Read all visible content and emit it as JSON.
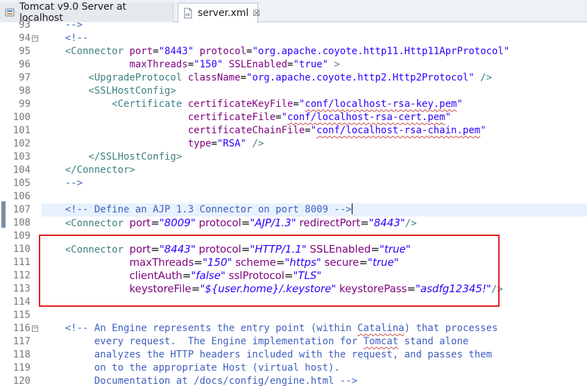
{
  "tabs": [
    {
      "label": "Tomcat v9.0 Server at localhost",
      "icon": "server-icon",
      "active": false
    },
    {
      "label": "server.xml",
      "icon": "xml-file-icon",
      "active": true,
      "close": "☒"
    }
  ],
  "colors": {
    "comment": "#3f5fbf",
    "tag": "#3f7f7f",
    "attr_name": "#7f007f",
    "attr_value": "#2a00ff",
    "highlight_box": "#e01b1b"
  },
  "editor": {
    "lines": [
      {
        "n": "93",
        "t": [
          {
            "c": "cm",
            "s": "    -->"
          }
        ]
      },
      {
        "n": "94",
        "fold": "−",
        "t": [
          {
            "c": "cm",
            "s": "    <!--"
          }
        ]
      },
      {
        "n": "95",
        "t": [
          {
            "c": "tg",
            "s": "    <Connector "
          },
          {
            "c": "an",
            "s": "port"
          },
          {
            "c": "",
            "s": "="
          },
          {
            "c": "av",
            "s": "\"8443\""
          },
          {
            "c": "",
            "s": " "
          },
          {
            "c": "an",
            "s": "protocol"
          },
          {
            "c": "",
            "s": "="
          },
          {
            "c": "av",
            "s": "\"org.apache.coyote.http11.Http11AprProtocol\""
          }
        ]
      },
      {
        "n": "96",
        "t": [
          {
            "c": "",
            "s": "               "
          },
          {
            "c": "an",
            "s": "maxThreads"
          },
          {
            "c": "",
            "s": "="
          },
          {
            "c": "av",
            "s": "\"150\""
          },
          {
            "c": "",
            "s": " "
          },
          {
            "c": "an",
            "s": "SSLEnabled"
          },
          {
            "c": "",
            "s": "="
          },
          {
            "c": "av",
            "s": "\"true\""
          },
          {
            "c": "tg",
            "s": " >"
          }
        ]
      },
      {
        "n": "97",
        "t": [
          {
            "c": "tg",
            "s": "        <UpgradeProtocol "
          },
          {
            "c": "an",
            "s": "className"
          },
          {
            "c": "",
            "s": "="
          },
          {
            "c": "av",
            "s": "\"org.apache.coyote.http2.Http2Protocol\""
          },
          {
            "c": "tg",
            "s": " />"
          }
        ]
      },
      {
        "n": "98",
        "t": [
          {
            "c": "tg",
            "s": "        <SSLHostConfig>"
          }
        ]
      },
      {
        "n": "99",
        "t": [
          {
            "c": "tg",
            "s": "            <Certificate "
          },
          {
            "c": "an",
            "s": "certificateKeyFile"
          },
          {
            "c": "",
            "s": "="
          },
          {
            "c": "av",
            "s": "\""
          },
          {
            "c": "av sq",
            "s": "conf/localhost-rsa-key.pem"
          },
          {
            "c": "av",
            "s": "\""
          }
        ]
      },
      {
        "n": "100",
        "t": [
          {
            "c": "",
            "s": "                         "
          },
          {
            "c": "an",
            "s": "certificateFile"
          },
          {
            "c": "",
            "s": "="
          },
          {
            "c": "av",
            "s": "\""
          },
          {
            "c": "av sq",
            "s": "conf/localhost-rsa-cert.pem"
          },
          {
            "c": "av",
            "s": "\""
          }
        ]
      },
      {
        "n": "101",
        "t": [
          {
            "c": "",
            "s": "                         "
          },
          {
            "c": "an",
            "s": "certificateChainFile"
          },
          {
            "c": "",
            "s": "="
          },
          {
            "c": "av",
            "s": "\""
          },
          {
            "c": "av sq",
            "s": "conf/localhost-rsa-chain.pem"
          },
          {
            "c": "av",
            "s": "\""
          }
        ]
      },
      {
        "n": "102",
        "t": [
          {
            "c": "",
            "s": "                         "
          },
          {
            "c": "an",
            "s": "type"
          },
          {
            "c": "",
            "s": "="
          },
          {
            "c": "av",
            "s": "\"RSA\""
          },
          {
            "c": "tg",
            "s": " />"
          }
        ]
      },
      {
        "n": "103",
        "t": [
          {
            "c": "tg",
            "s": "        </SSLHostConfig>"
          }
        ]
      },
      {
        "n": "104",
        "t": [
          {
            "c": "tg",
            "s": "    </Connector>"
          }
        ]
      },
      {
        "n": "105",
        "t": [
          {
            "c": "cm",
            "s": "    -->"
          }
        ]
      },
      {
        "n": "106",
        "t": []
      },
      {
        "n": "107",
        "highlight": true,
        "t": [
          {
            "c": "cm",
            "s": "    <!-- Define an AJP 1.3 Connector on port 8009 -->"
          }
        ]
      },
      {
        "n": "108",
        "t": [
          {
            "c": "tg",
            "s": "    <Connector "
          },
          {
            "c": "an prop",
            "s": "port"
          },
          {
            "c": "prop",
            "s": "="
          },
          {
            "c": "av it prop",
            "s": "\"8009\""
          },
          {
            "c": "prop",
            "s": " "
          },
          {
            "c": "an prop",
            "s": "protocol"
          },
          {
            "c": "prop",
            "s": "="
          },
          {
            "c": "av it prop",
            "s": "\"AJP/1.3\""
          },
          {
            "c": "prop",
            "s": " "
          },
          {
            "c": "an prop",
            "s": "redirectPort"
          },
          {
            "c": "prop",
            "s": "="
          },
          {
            "c": "av it prop",
            "s": "\"8443\""
          },
          {
            "c": "tg",
            "s": "/>"
          }
        ]
      },
      {
        "n": "109",
        "t": []
      },
      {
        "n": "110",
        "t": [
          {
            "c": "tg",
            "s": "    <Connector "
          },
          {
            "c": "an prop",
            "s": "port"
          },
          {
            "c": "prop",
            "s": "="
          },
          {
            "c": "av it prop",
            "s": "\"8443\""
          },
          {
            "c": "prop",
            "s": " "
          },
          {
            "c": "an prop",
            "s": "protocol"
          },
          {
            "c": "prop",
            "s": "="
          },
          {
            "c": "av it prop",
            "s": "\"HTTP/1.1\""
          },
          {
            "c": "prop",
            "s": " "
          },
          {
            "c": "an prop",
            "s": "SSLEnabled"
          },
          {
            "c": "prop",
            "s": "="
          },
          {
            "c": "av it prop",
            "s": "\"true\""
          }
        ]
      },
      {
        "n": "111",
        "t": [
          {
            "c": "",
            "s": "               "
          },
          {
            "c": "an prop",
            "s": "maxThreads"
          },
          {
            "c": "prop",
            "s": "="
          },
          {
            "c": "av it prop",
            "s": "\"150\""
          },
          {
            "c": "prop",
            "s": " "
          },
          {
            "c": "an prop",
            "s": "scheme"
          },
          {
            "c": "prop",
            "s": "="
          },
          {
            "c": "av it prop",
            "s": "\"https\""
          },
          {
            "c": "prop",
            "s": " "
          },
          {
            "c": "an prop",
            "s": "secure"
          },
          {
            "c": "prop",
            "s": "="
          },
          {
            "c": "av it prop",
            "s": "\"true\""
          }
        ]
      },
      {
        "n": "112",
        "t": [
          {
            "c": "",
            "s": "               "
          },
          {
            "c": "an prop",
            "s": "clientAuth"
          },
          {
            "c": "prop",
            "s": "="
          },
          {
            "c": "av it prop",
            "s": "\"false\""
          },
          {
            "c": "prop",
            "s": " "
          },
          {
            "c": "an prop",
            "s": "sslProtocol"
          },
          {
            "c": "prop",
            "s": "="
          },
          {
            "c": "av it prop",
            "s": "\"TLS\""
          }
        ]
      },
      {
        "n": "113",
        "t": [
          {
            "c": "",
            "s": "               "
          },
          {
            "c": "an prop",
            "s": "keystoreFile"
          },
          {
            "c": "prop",
            "s": "="
          },
          {
            "c": "av it prop",
            "s": "\"${user.home}/.keystore\""
          },
          {
            "c": "prop",
            "s": " "
          },
          {
            "c": "an prop",
            "s": "keystorePass"
          },
          {
            "c": "prop",
            "s": "="
          },
          {
            "c": "av it prop",
            "s": "\"asdfg12345!\""
          },
          {
            "c": "tg",
            "s": "/>"
          }
        ]
      },
      {
        "n": "114",
        "t": []
      },
      {
        "n": "115",
        "t": []
      },
      {
        "n": "116",
        "fold": "−",
        "t": [
          {
            "c": "cm",
            "s": "    <!-- An Engine represents the entry point (within "
          },
          {
            "c": "cm sq",
            "s": "Catalina"
          },
          {
            "c": "cm",
            "s": ") that processes"
          }
        ]
      },
      {
        "n": "117",
        "t": [
          {
            "c": "cm",
            "s": "         every request.  The Engine implementation for "
          },
          {
            "c": "cm sq",
            "s": "Tomcat"
          },
          {
            "c": "cm",
            "s": " stand alone"
          }
        ]
      },
      {
        "n": "118",
        "t": [
          {
            "c": "cm",
            "s": "         analyzes the HTTP headers included with the request, and passes them"
          }
        ]
      },
      {
        "n": "119",
        "t": [
          {
            "c": "cm",
            "s": "         on to the appropriate Host (virtual host)."
          }
        ]
      },
      {
        "n": "120",
        "t": [
          {
            "c": "cm",
            "s": "         Documentation at /docs/config/engine.html -->"
          }
        ]
      }
    ]
  }
}
